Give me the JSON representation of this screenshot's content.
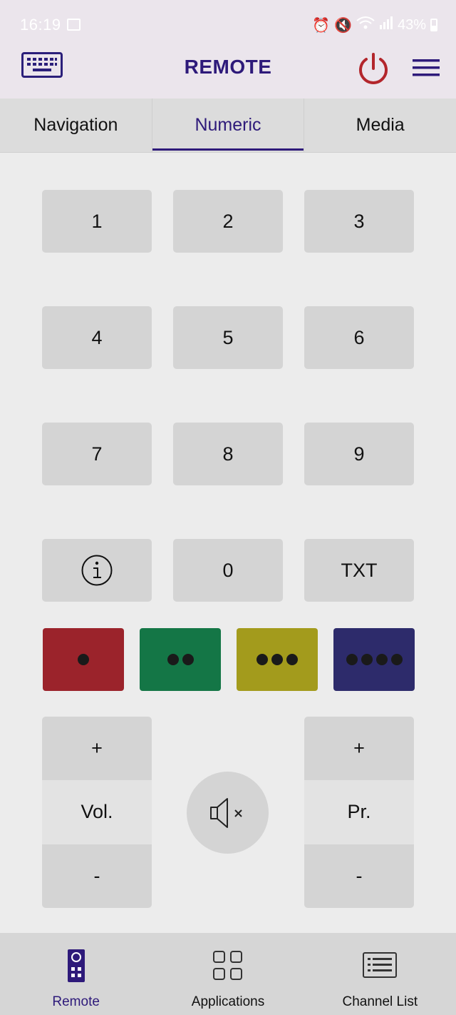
{
  "status_bar": {
    "time": "16:19",
    "battery": "43%"
  },
  "app_bar": {
    "title": "REMOTE",
    "keyboard_icon": "keyboard-icon",
    "power_icon": "power-icon",
    "menu_icon": "menu-icon"
  },
  "tabs": [
    {
      "label": "Navigation",
      "active": false
    },
    {
      "label": "Numeric",
      "active": true
    },
    {
      "label": "Media",
      "active": false
    }
  ],
  "keypad": {
    "k1": "1",
    "k2": "2",
    "k3": "3",
    "k4": "4",
    "k5": "5",
    "k6": "6",
    "k7": "7",
    "k8": "8",
    "k9": "9",
    "k0": "0",
    "txt": "TXT",
    "info_icon": "info-icon"
  },
  "color_buttons": [
    {
      "name": "red",
      "color": "#9b232b",
      "dots": 1
    },
    {
      "name": "green",
      "color": "#147646",
      "dots": 2
    },
    {
      "name": "yellow",
      "color": "#a39b1c",
      "dots": 3
    },
    {
      "name": "blue",
      "color": "#2d2b6b",
      "dots": 4
    }
  ],
  "volume": {
    "plus": "+",
    "label": "Vol.",
    "minus": "-"
  },
  "program": {
    "plus": "+",
    "label": "Pr.",
    "minus": "-"
  },
  "mute_icon": "mute-icon",
  "bottom_nav": [
    {
      "label": "Remote",
      "icon": "remote-icon",
      "active": true
    },
    {
      "label": "Applications",
      "icon": "apps-grid-icon",
      "active": false
    },
    {
      "label": "Channel List",
      "icon": "channel-list-icon",
      "active": false
    }
  ],
  "colors": {
    "accent": "#2e1a7a",
    "power": "#b3262c",
    "appbar_bg": "#ebe5ec",
    "button_bg": "#d4d4d4"
  }
}
